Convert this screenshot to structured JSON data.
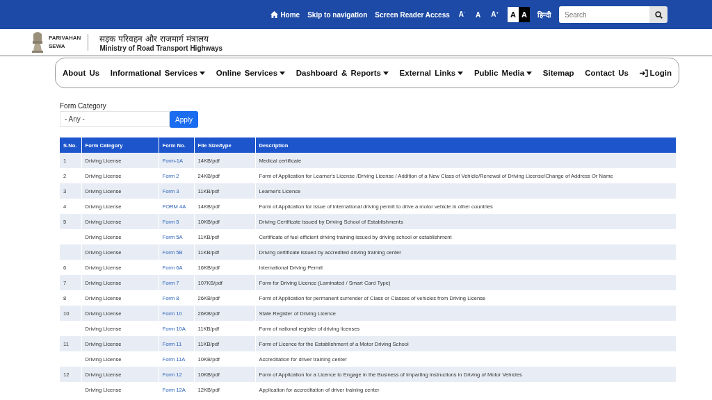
{
  "top_bar": {
    "links": [
      {
        "label": "Home",
        "kind": "home"
      },
      {
        "label": "Skip to navigation",
        "kind": "text"
      },
      {
        "label": "Screen Reader Access",
        "kind": "text"
      }
    ],
    "font_sizes": [
      "A$^{-}$",
      "A",
      "A$^{+}$"
    ],
    "contrast": [
      {
        "label": "A",
        "kind": "light"
      },
      {
        "label": "A",
        "kind": "dark"
      }
    ],
    "language": "हिन्दी",
    "search": {
      "placeholder": "Search"
    }
  },
  "header": {
    "logo_lines": [
      "PARIVAHAN",
      "SEWA"
    ],
    "title_hindi": "सड़क परिवहन और राजमार्ग मंत्रालय",
    "title": "Ministry of Road Transport Highways"
  },
  "nav": [
    {
      "label": "About Us",
      "dropdown": false,
      "kind": "text"
    },
    {
      "label": "Informational Services",
      "dropdown": true,
      "kind": "text"
    },
    {
      "label": "Online Services",
      "dropdown": true,
      "kind": "text"
    },
    {
      "label": "Dashboard & Reports",
      "dropdown": true,
      "kind": "text"
    },
    {
      "label": "External Links",
      "dropdown": true,
      "kind": "text"
    },
    {
      "label": "Public Media",
      "dropdown": true,
      "kind": "text"
    },
    {
      "label": "Sitemap",
      "dropdown": false,
      "kind": "text"
    },
    {
      "label": "Contact Us",
      "dropdown": false,
      "kind": "text"
    },
    {
      "label": "Login",
      "dropdown": false,
      "kind": "login"
    }
  ],
  "filter": {
    "label": "Form Category",
    "value": "- Any -",
    "button": "Apply"
  },
  "table": {
    "columns": [
      "S.No.",
      "Form Category",
      "Form No.",
      "File Size/type",
      "Description"
    ],
    "rows": [
      [
        "1",
        "Driving License",
        "Form-1A",
        "14KB/pdf",
        "Medical certificate"
      ],
      [
        "2",
        "Driving License",
        "Form 2",
        "24KB/pdf",
        "Form of Application for Learner's License /Driving License / Addition of a New Class of Vehicle/Renewal of Driving License/Change of Address Or Name"
      ],
      [
        "3",
        "Driving License",
        "Form 3",
        "11KB/pdf",
        "Learner's Licence"
      ],
      [
        "4",
        "Driving License",
        "FORM 4A",
        "14KB/pdf",
        "Form of Application for issue of international driving permit to drive a motor vehicle in other countries"
      ],
      [
        "5",
        "Driving License",
        "Form 5",
        "10KB/pdf",
        "Driving Certificate issued by Driving School of Establishments"
      ],
      [
        "",
        "Driving License",
        "Form 5A",
        "11KB/pdf",
        "Certificate of fuel efficient driving training issued by driving school or establishment"
      ],
      [
        "",
        "Driving License",
        "Form 5B",
        "11KB/pdf",
        "Driving certificate issued by accredited driving training center"
      ],
      [
        "6",
        "Driving License",
        "Form 6A",
        "16KB/pdf",
        "International Driving Permit"
      ],
      [
        "7",
        "Driving License",
        "Form 7",
        "107KB/pdf",
        "Form for Driving Licence (Laminated / Smart Card Type)"
      ],
      [
        "8",
        "Driving License",
        "Form 8",
        "26KB/pdf",
        "Form of Application for permanent surrender of Class or Classes of vehicles from Driving License"
      ],
      [
        "10",
        "Driving License",
        "Form 10",
        "26KB/pdf",
        "State Register of Driving Licence"
      ],
      [
        "",
        "Driving License",
        "Form 10A",
        "11KB/pdf",
        "Form of national register of driving licenses"
      ],
      [
        "11",
        "Driving License",
        "Form 11",
        "11KB/pdf",
        "Form of Licence for the Establishment of a Motor Driving School"
      ],
      [
        "",
        "Driving License",
        "Form 11A",
        "10KB/pdf",
        "Accreditation for driver training center"
      ],
      [
        "12",
        "Driving License",
        "Form 12",
        "10KB/pdf",
        "Form of Application for a Licence to Engage in the Business of Imparting Instructions in Driving of Motor Vehicles"
      ],
      [
        "",
        "Driving License",
        "Form 12A",
        "12KB/pdf",
        "Application for accreditation of driver training center"
      ]
    ]
  }
}
